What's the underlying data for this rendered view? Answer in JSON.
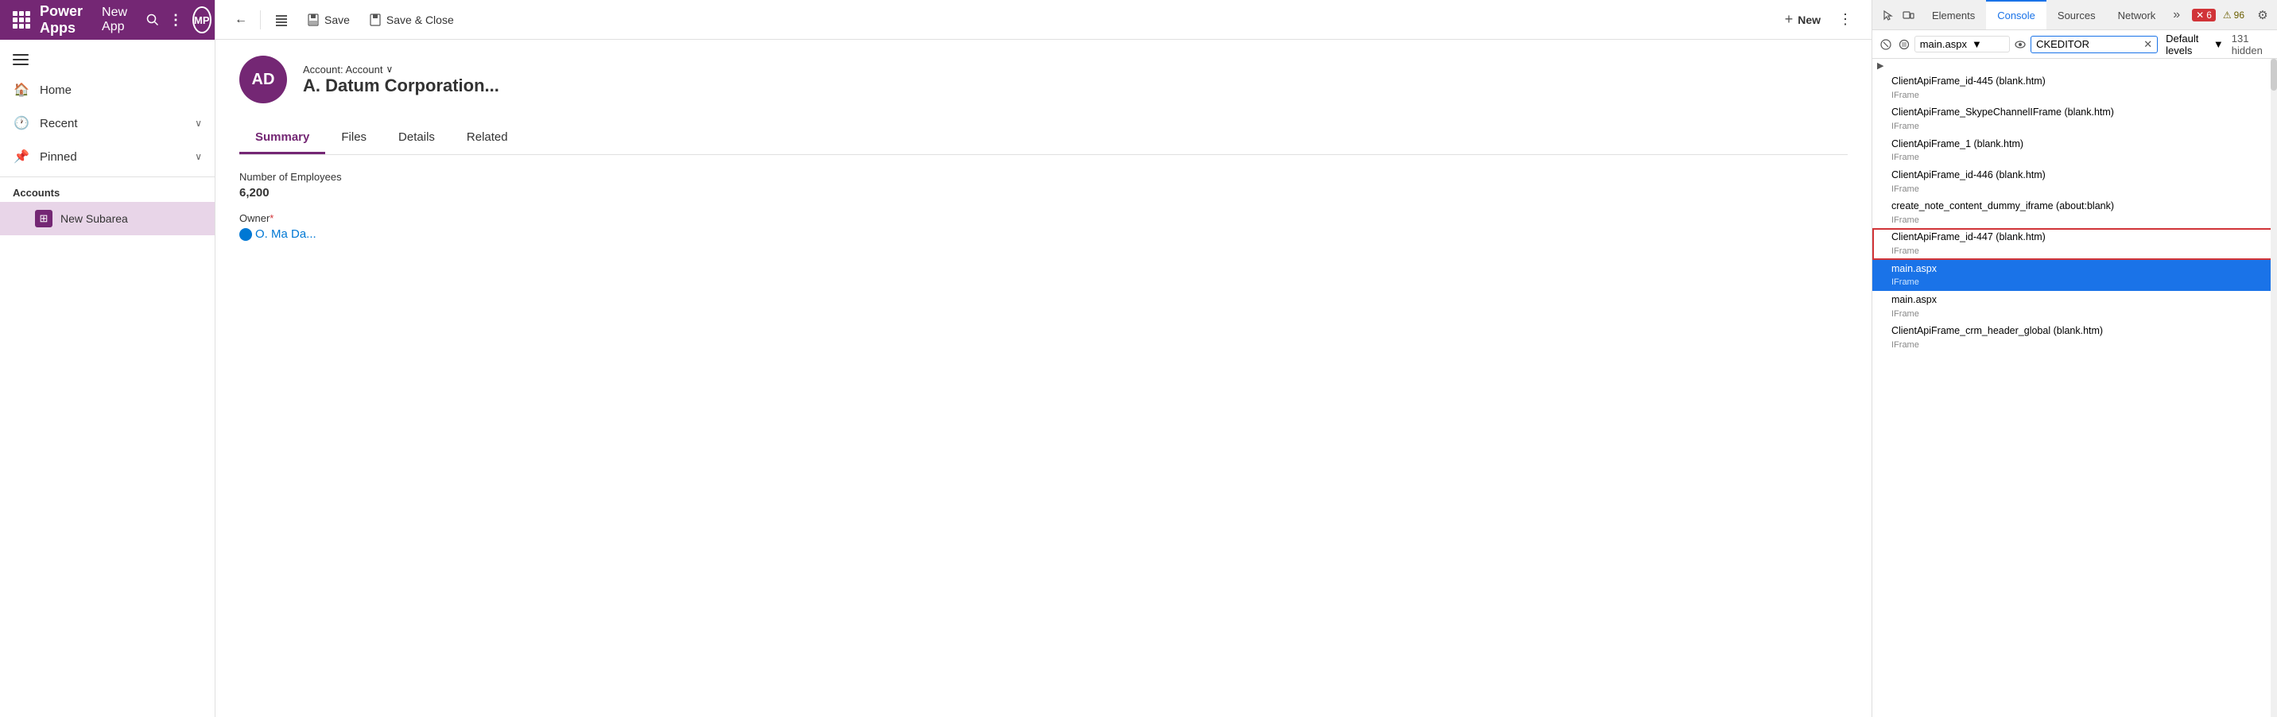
{
  "app": {
    "title": "Power Apps",
    "app_name": "New App",
    "avatar_initials": "MP"
  },
  "sidebar": {
    "hamburger_label": "Collapse",
    "items": [
      {
        "id": "home",
        "label": "Home",
        "icon": "🏠"
      },
      {
        "id": "recent",
        "label": "Recent",
        "icon": "🕐",
        "has_chevron": true
      },
      {
        "id": "pinned",
        "label": "Pinned",
        "icon": "📌",
        "has_chevron": true
      }
    ],
    "section_label": "Accounts",
    "sub_items": [
      {
        "id": "new-subarea",
        "label": "New Subarea",
        "icon": "⊞"
      }
    ]
  },
  "command_bar": {
    "back_label": "←",
    "save_label": "Save",
    "save_close_label": "Save & Close",
    "new_label": "New",
    "more_label": "⋮"
  },
  "record": {
    "avatar_initials": "AD",
    "entity_label": "Account: Account",
    "name": "A. Datum Corporation...",
    "tabs": [
      {
        "id": "summary",
        "label": "Summary",
        "active": true
      },
      {
        "id": "files",
        "label": "Files"
      },
      {
        "id": "details",
        "label": "Details"
      },
      {
        "id": "related",
        "label": "Related"
      }
    ],
    "fields": [
      {
        "id": "employees",
        "label": "Number of Employees",
        "value": "6,200",
        "required": false
      },
      {
        "id": "owner",
        "label": "Owner",
        "value": "O. Ma Da...",
        "required": true,
        "is_link": true
      }
    ]
  },
  "devtools": {
    "tabs": [
      {
        "id": "elements",
        "label": "Elements"
      },
      {
        "id": "console",
        "label": "Console",
        "active": true
      },
      {
        "id": "sources",
        "label": "Sources"
      },
      {
        "id": "network",
        "label": "Network"
      }
    ],
    "more_tabs": "»",
    "toolbar": {
      "context_value": "main.aspx",
      "filter_value": "CKEDITOR",
      "levels_label": "Default levels",
      "hidden_count": "131 hidden"
    },
    "dropdown_items": [
      {
        "id": "frame-445",
        "main": "ClientApiFrame_id-445 (blank.htm)",
        "sub": "IFrame",
        "selected": false,
        "highlighted": false
      },
      {
        "id": "frame-skype",
        "main": "ClientApiFrame_SkypeChannelIFrame (blank.htm)",
        "sub": "IFrame",
        "selected": false,
        "highlighted": false
      },
      {
        "id": "frame-1",
        "main": "ClientApiFrame_1 (blank.htm)",
        "sub": "IFrame",
        "selected": false,
        "highlighted": false
      },
      {
        "id": "frame-446",
        "main": "ClientApiFrame_id-446 (blank.htm)",
        "sub": "IFrame",
        "selected": false,
        "highlighted": false
      },
      {
        "id": "frame-note",
        "main": "create_note_content_dummy_iframe (about:blank)",
        "sub": "IFrame",
        "selected": false,
        "highlighted": false
      },
      {
        "id": "frame-447",
        "main": "ClientApiFrame_id-447 (blank.htm)",
        "sub": "IFrame",
        "selected": false,
        "highlighted": true
      },
      {
        "id": "main-aspx",
        "main": "main.aspx",
        "sub": "IFrame",
        "selected": true,
        "highlighted": false
      },
      {
        "id": "main-aspx-2",
        "main": "main.aspx",
        "sub": "IFrame",
        "selected": false,
        "highlighted": false
      },
      {
        "id": "frame-crm-header",
        "main": "ClientApiFrame_crm_header_global (blank.htm)",
        "sub": "IFrame",
        "selected": false,
        "highlighted": false
      }
    ],
    "error_count": "6",
    "warning_count": "96",
    "error_icon": "✕",
    "warning_icon": "⚠"
  }
}
